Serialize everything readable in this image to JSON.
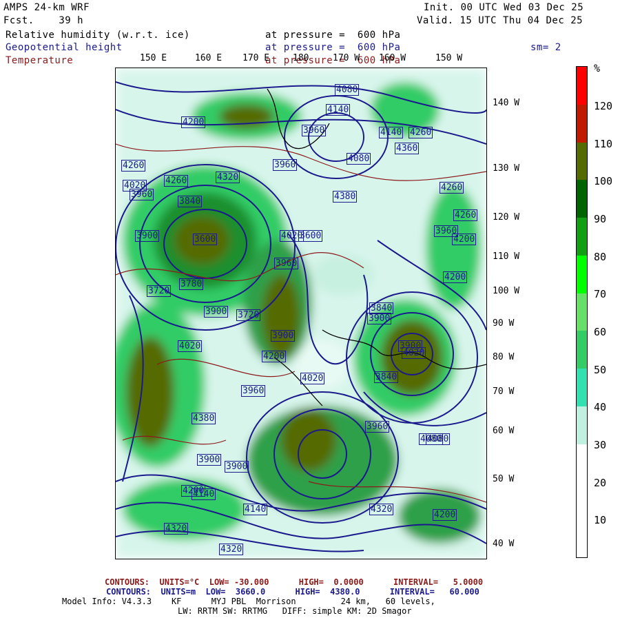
{
  "header": {
    "model": "AMPS 24-km WRF",
    "fcst": "Fcst.    39 h",
    "init": "Init. 00 UTC Wed 03 Dec 25",
    "valid": "Valid. 15 UTC Thu 04 Dec 25"
  },
  "fields": {
    "rh_name": "Relative humidity (w.r.t. ice)",
    "rh_level": "at pressure =  600 hPa",
    "gh_name": "Geopotential height",
    "gh_level": "at pressure =  600 hPa",
    "t_name": "Temperature",
    "t_level": "at pressure =  600 hPa",
    "smoothing": "sm= 2"
  },
  "longitude_labels": [
    "150 E",
    "160 E",
    "170 E",
    "180",
    "170 W",
    "160 W",
    "150 W"
  ],
  "latitude_labels": [
    "140 W",
    "130 W",
    "120 W",
    "110 W",
    "100 W",
    "90 W",
    "80 W",
    "70 W",
    "60 W",
    "50 W",
    "40 W"
  ],
  "height_labels": [
    "4260",
    "4140",
    "3960",
    "4080",
    "4140",
    "4360",
    "4260",
    "4020",
    "3840",
    "3900",
    "3600",
    "3780",
    "4200",
    "3960",
    "4080",
    "3720",
    "3900",
    "3720",
    "3960",
    "3900",
    "4020",
    "3960",
    "4200",
    "3900",
    "4380",
    "4320",
    "4200",
    "4140",
    "3900",
    "3960",
    "4020",
    "4260",
    "4320",
    "4380",
    "4260",
    "3840",
    "3900",
    "4020",
    "3960",
    "3900",
    "3960",
    "4080",
    "4200",
    "4200",
    "4080",
    "4140",
    "3600",
    "3840",
    "4020",
    "4200",
    "4320",
    "4320",
    "4260"
  ],
  "colorbar": {
    "unit": "%",
    "labels": [
      "120",
      "110",
      "100",
      "90",
      "80",
      "70",
      "60",
      "50",
      "40",
      "30",
      "20",
      "10"
    ],
    "colors": [
      "#ff0000",
      "#c01a00",
      "#556b00",
      "#006400",
      "#12a012",
      "#00ff00",
      "#66e066",
      "#33cc66",
      "#33e0b0",
      "#c0f0e0",
      "#ffffff",
      "#ffffff",
      "#ffffff"
    ]
  },
  "footer": {
    "t_contours": "CONTOURS:  UNITS=°C  LOW= -30.000      HIGH=  0.0000      INTERVAL=   5.0000",
    "h_contours": "CONTOURS:  UNITS=m  LOW=  3660.0      HIGH=  4380.0      INTERVAL=   60.000",
    "model_info": "Model Info: V4.3.3    KF      MYJ PBL  Morrison         24 km,   60 levels,",
    "physics": "LW: RRTM SW: RRTMG   DIFF: simple KM: 2D Smagor"
  }
}
